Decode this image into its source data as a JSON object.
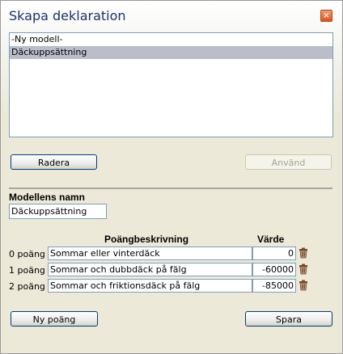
{
  "window": {
    "title": "Skapa deklaration",
    "close_label": "×"
  },
  "declarations": {
    "items": [
      {
        "label": "-Ny modell-",
        "selected": false
      },
      {
        "label": "Däckuppsättning",
        "selected": true
      }
    ]
  },
  "buttons": {
    "delete_label": "Radera",
    "use_label": "Använd",
    "new_point_label": "Ny poäng",
    "save_label": "Spara"
  },
  "model": {
    "name_label": "Modellens namn",
    "name_value": "Däckuppsättning"
  },
  "points_table": {
    "description_header": "Poängbeskrivning",
    "value_header": "Värde",
    "rows": [
      {
        "label": "0 poäng",
        "description": "Sommar eller vinterdäck",
        "value": "0"
      },
      {
        "label": "1 poäng",
        "description": "Sommar och dubbdäck på fälg",
        "value": "-60000"
      },
      {
        "label": "2 poäng",
        "description": "Sommar och friktionsdäck på fälg",
        "value": "-85000"
      }
    ]
  },
  "colors": {
    "title": "#17336b",
    "selection": "#b9bec9",
    "close_button": "#d9541e"
  },
  "icons": {
    "close": "close-icon",
    "delete_row": "trash-icon"
  }
}
